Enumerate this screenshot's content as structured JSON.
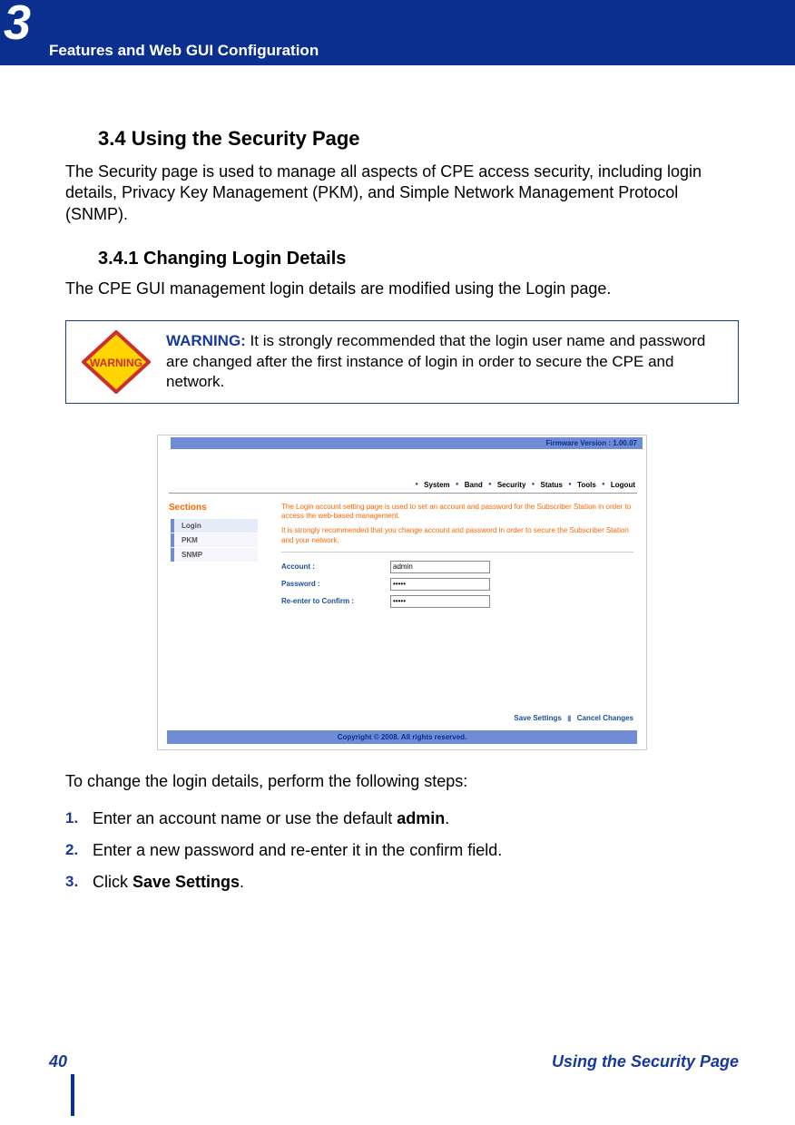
{
  "chapter": {
    "number": "3",
    "title": "Features and Web GUI Configuration"
  },
  "section": {
    "number_title": "3.4 Using the Security Page",
    "intro": "The Security page is used to manage all aspects of CPE access security, including login details, Privacy Key Management (PKM), and Simple Network Management Protocol (SNMP)."
  },
  "subsection": {
    "number_title": "3.4.1 Changing Login Details",
    "intro": "The CPE GUI management login details are modified using the Login page."
  },
  "warning": {
    "icon_text": "WARNING",
    "label": "WARNING:",
    "body": " It is strongly recommended that the login user name and password are changed after the first instance of login in order to secure the CPE and network."
  },
  "screenshot": {
    "firmware": "Firmware Version : 1.00.07",
    "menu": [
      "System",
      "Band",
      "Security",
      "Status",
      "Tools",
      "Logout"
    ],
    "sections_label": "Sections",
    "side_items": [
      "Login",
      "PKM",
      "SNMP"
    ],
    "panel_desc1": "The Login account setting page is used to set an account and password for the Subscriber Station in order to access the web-based management.",
    "panel_desc2": "It is strongly recommended that you change account and password in order to secure the Subscriber Station and your network.",
    "form": {
      "account_label": "Account :",
      "account_value": "admin",
      "password_label": "Password :",
      "password_value": "•••••",
      "reenter_label": "Re-enter to Confirm :",
      "reenter_value": "•••••"
    },
    "save_label": "Save Settings",
    "cancel_label": "Cancel Changes",
    "copyright": "Copyright © 2008.  All rights reserved."
  },
  "after_text": "To change the login details, perform the following steps:",
  "steps": [
    {
      "num": "1.",
      "pre": "Enter an account name or use the default ",
      "bold": "admin",
      "post": "."
    },
    {
      "num": "2.",
      "pre": "Enter a new password and re-enter it in the confirm field.",
      "bold": "",
      "post": ""
    },
    {
      "num": "3.",
      "pre": "Click ",
      "bold": "Save Settings",
      "post": "."
    }
  ],
  "footer": {
    "page": "40",
    "section_name": "Using the Security Page"
  }
}
